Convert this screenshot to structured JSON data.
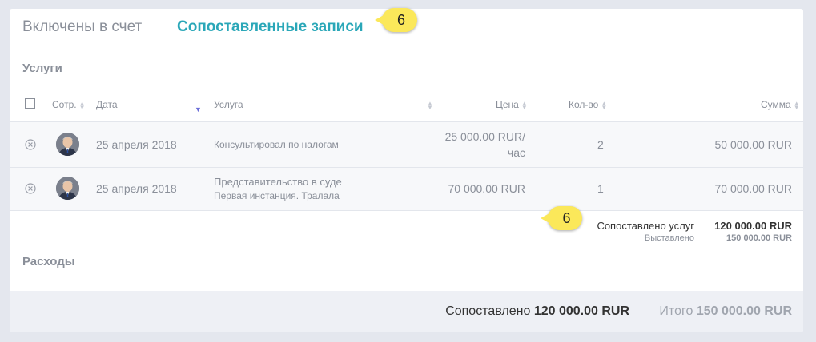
{
  "tabs": {
    "included": "Включены в счет",
    "matched": "Сопоставленные записи"
  },
  "callouts": {
    "tab_badge": "6",
    "summary_badge": "6"
  },
  "sections": {
    "services": "Услуги",
    "expenses": "Расходы"
  },
  "table": {
    "columns": {
      "employee": "Сотр.",
      "date": "Дата",
      "service": "Услуга",
      "price": "Цена",
      "quantity": "Кол-во",
      "total": "Сумма"
    },
    "rows": [
      {
        "date": "25 апреля 2018",
        "service": "Консультировал по налогам",
        "service_note": "",
        "price_line1": "25 000.00 RUR/",
        "price_line2": "час",
        "quantity": "2",
        "total": "50 000.00 RUR"
      },
      {
        "date": "25 апреля 2018",
        "service": "Представительство в суде",
        "service_note": "Первая инстанция. Тралала",
        "price_line1": "70 000.00 RUR",
        "price_line2": "",
        "quantity": "1",
        "total": "70 000.00 RUR"
      }
    ]
  },
  "summary": {
    "matched_label": "Сопоставлено услуг",
    "matched_value": "120 000.00 RUR",
    "invoiced_label": "Выставлено",
    "invoiced_value": "150 000.00 RUR"
  },
  "footer": {
    "matched_label": "Сопоставлено",
    "matched_value": "120 000.00 RUR",
    "total_label": "Итого",
    "total_value": "150 000.00 RUR"
  },
  "colors": {
    "accent": "#2aa7b8",
    "callout": "#fbe85a",
    "muted_text": "#8a8f99",
    "sort_active": "#6b6ed8"
  }
}
